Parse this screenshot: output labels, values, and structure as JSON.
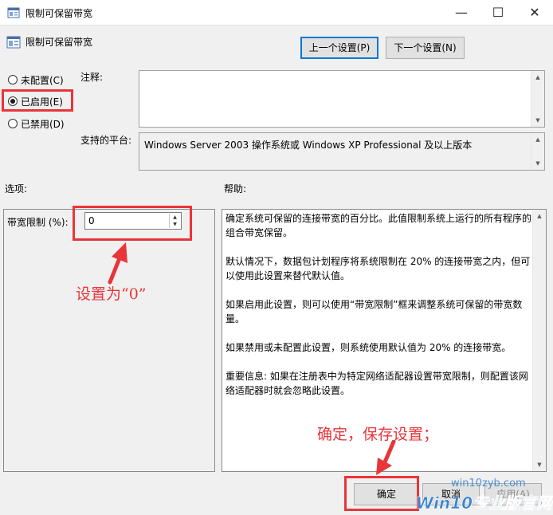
{
  "window": {
    "title": "限制可保留带宽",
    "minimize": "—",
    "maximize": "☐",
    "close": "✕"
  },
  "header": {
    "title": "限制可保留带宽",
    "prev_button": "上一个设置(P)",
    "next_button": "下一个设置(N)"
  },
  "radios": [
    {
      "label": "未配置(C)",
      "checked": false
    },
    {
      "label": "已启用(E)",
      "checked": true
    },
    {
      "label": "已禁用(D)",
      "checked": false
    }
  ],
  "comment": {
    "label": "注释:",
    "value": ""
  },
  "platform": {
    "label": "支持的平台:",
    "value": "Windows Server 2003 操作系统或 Windows XP Professional 及以上版本"
  },
  "options": {
    "label": "选项:",
    "bandwidth_label": "带宽限制 (%):",
    "bandwidth_value": "0"
  },
  "help": {
    "label": "帮助:",
    "paragraphs": [
      "确定系统可保留的连接带宽的百分比。此值限制系统上运行的所有程序的组合带宽保留。",
      "默认情况下，数据包计划程序将系统限制在 20% 的连接带宽之内，但可以使用此设置来替代默认值。",
      "如果启用此设置，则可以使用“带宽限制”框来调整系统可保留的带宽数量。",
      "如果禁用或未配置此设置，则系统使用默认值为 20% 的连接带宽。",
      "重要信息: 如果在注册表中为特定网络适配器设置带宽限制，则配置该网络适配器时就会忽略此设置。"
    ]
  },
  "annotations": {
    "set_zero": "设置为“0”",
    "confirm_save": "确定，保存设置；"
  },
  "footer": {
    "ok": "确定",
    "cancel": "取消",
    "apply": "应用(A)"
  },
  "watermark": {
    "url": "win10zyb.com",
    "brand": "Win10专业版官网"
  },
  "colors": {
    "highlight_red": "#e8353a",
    "focus_blue": "#0078d7",
    "watermark_blue": "#1a73c8"
  }
}
